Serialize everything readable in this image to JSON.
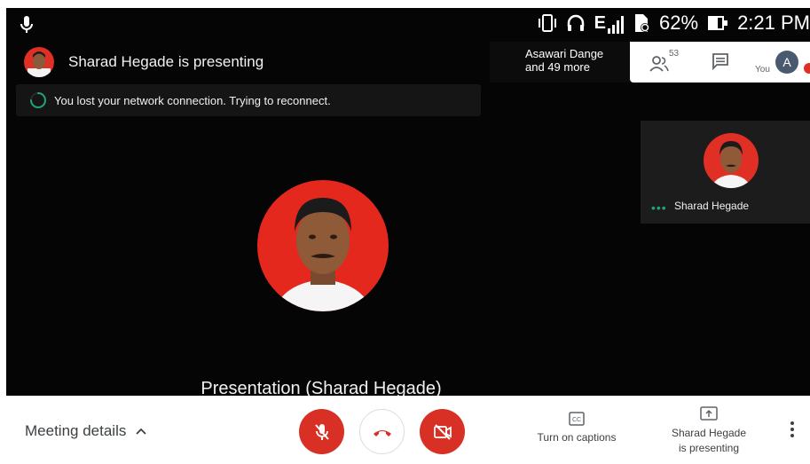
{
  "status_bar": {
    "battery": "62%",
    "time": "2:21 PM",
    "network": "E"
  },
  "presenter": {
    "banner": "Sharad Hegade is presenting"
  },
  "header": {
    "participants_line1": "Asawari Dange",
    "participants_line2": "and 49 more",
    "people_count": "53",
    "you_label": "You",
    "you_initial": "A"
  },
  "toast": {
    "message": "You lost your network connection. Trying to reconnect."
  },
  "main": {
    "presentation_label": "Presentation (Sharad Hegade)"
  },
  "tile": {
    "dots": "•••",
    "name": "Sharad Hegade"
  },
  "toolbar": {
    "meeting_details": "Meeting details",
    "captions_label": "Turn on captions",
    "presenting_line1": "Sharad Hegade",
    "presenting_line2": "is presenting"
  },
  "colors": {
    "danger": "#d93025",
    "accent_green": "#1fa37a",
    "avatar_red": "#e02f24"
  }
}
